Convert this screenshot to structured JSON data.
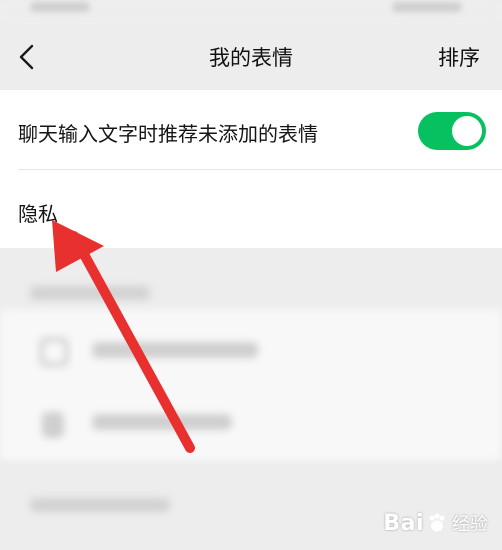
{
  "navbar": {
    "title": "我的表情",
    "sort_label": "排序"
  },
  "settings": {
    "recommend_label": "聊天输入文字时推荐未添加的表情",
    "recommend_toggle_on": true,
    "privacy_label": "隐私"
  },
  "colors": {
    "toggle_on": "#07c160",
    "annotation_arrow": "#e8302f"
  },
  "watermark": {
    "text_prefix": "Bai",
    "text_suffix": "经验"
  },
  "icons": {
    "back": "chevron-left-icon"
  }
}
